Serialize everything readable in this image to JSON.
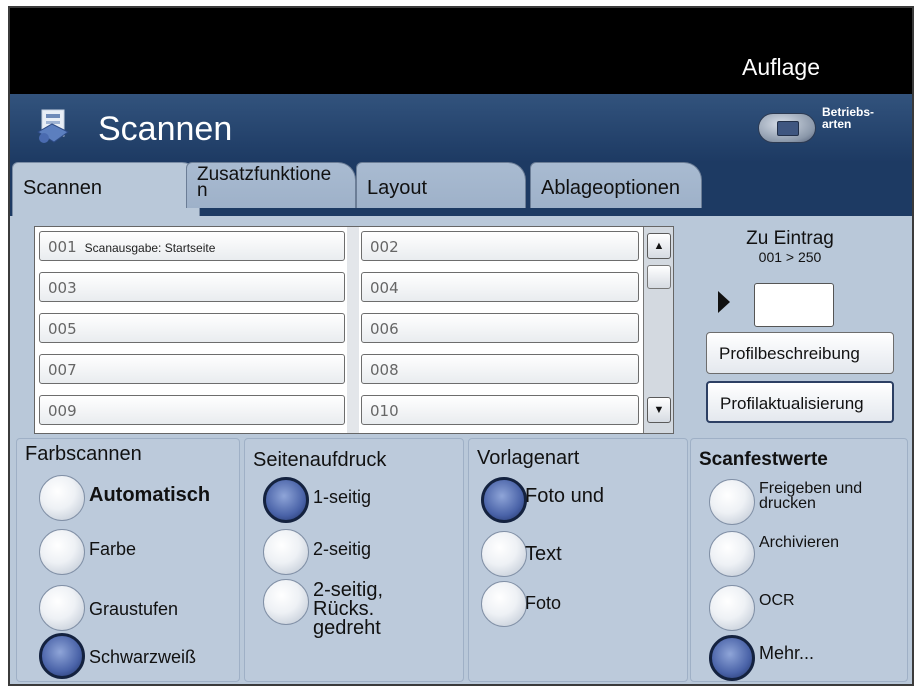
{
  "header": {
    "top_right": "Auflage",
    "app_title": "Scannen",
    "mode_label_line1": "Betriebs-",
    "mode_label_line2": "arten"
  },
  "tabs": [
    {
      "label": "Scannen",
      "active": true
    },
    {
      "label": "Zusatzfunktione\nn",
      "active": false
    },
    {
      "label": "Layout",
      "active": false
    },
    {
      "label": "Ablageoptionen",
      "active": false
    }
  ],
  "templates": [
    {
      "num": "001",
      "name": "Scanausgabe: Startseite"
    },
    {
      "num": "002",
      "name": ""
    },
    {
      "num": "003",
      "name": ""
    },
    {
      "num": "004",
      "name": ""
    },
    {
      "num": "005",
      "name": ""
    },
    {
      "num": "006",
      "name": ""
    },
    {
      "num": "007",
      "name": ""
    },
    {
      "num": "008",
      "name": ""
    },
    {
      "num": "009",
      "name": ""
    },
    {
      "num": "010",
      "name": ""
    }
  ],
  "goto": {
    "label": "Zu Eintrag",
    "range": "001 > 250",
    "value": ""
  },
  "buttons": {
    "profile_description": "Profilbeschreibung",
    "profile_update": "Profilaktualisierung"
  },
  "groups": {
    "color": {
      "title": "Farbscannen",
      "options": [
        "Automatisch",
        "Farbe",
        "Graustufen",
        "Schwarzweiß"
      ],
      "selected": "Schwarzweiß"
    },
    "sides": {
      "title": "Seitenaufdruck",
      "options": [
        "1-seitig",
        "2-seitig",
        "2-seitig,\nRücks.\ngedreht"
      ],
      "selected": "1-seitig"
    },
    "original": {
      "title": "Vorlagenart",
      "options": [
        "Foto und",
        "Text",
        "Foto"
      ],
      "selected": "Foto und"
    },
    "presets": {
      "title": "Scanfestwerte",
      "options": [
        "Freigeben und\ndrucken",
        "Archivieren",
        "OCR",
        "Mehr..."
      ],
      "selected": "Mehr..."
    }
  },
  "colors": {
    "header_bg": "#1d3a63",
    "panel_bg": "#b9c8d9",
    "radio_selected": "#4a63a8"
  }
}
